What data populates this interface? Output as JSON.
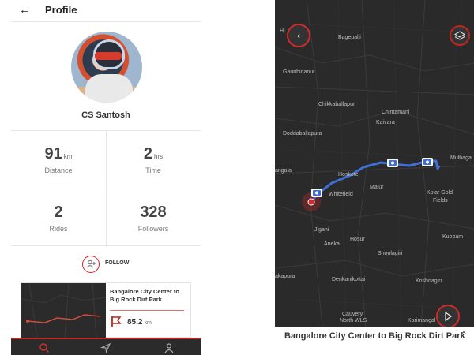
{
  "profile": {
    "header_title": "Profile",
    "name": "CS Santosh",
    "stats": [
      {
        "value": "91",
        "unit": "km",
        "label": "Distance"
      },
      {
        "value": "2",
        "unit": "hrs",
        "label": "Time"
      },
      {
        "value": "2",
        "unit": "",
        "label": "Rides"
      },
      {
        "value": "328",
        "unit": "",
        "label": "Followers"
      }
    ],
    "follow_label": "FOLLOW",
    "ride": {
      "title": "Bangalore City Center to Big Rock Dirt Park",
      "distance": "85.2",
      "distance_unit": "km"
    }
  },
  "map": {
    "labels": [
      "Bagepalli",
      "Gauribidanur",
      "Chikkaballapur",
      "Chintamani",
      "Kaivara",
      "Doddaballapura",
      "Hoskote",
      "Malur",
      "Mulbagal",
      "Whitefield",
      "Kolar Gold",
      "Fields",
      "Jigani",
      "Anekal",
      "Hosur",
      "Kuppam",
      "Shoolagiri",
      "Denkanikottai",
      "Krishnagiri",
      "Cauvery",
      "North WLS",
      "Karimangal",
      "Hi",
      "angala",
      "akapura"
    ],
    "route_title": "Bangalore City Center to Big Rock Dirt Park"
  },
  "colors": {
    "accent": "#d32b2b",
    "route": "#3d6fd6",
    "map_bg": "#2a2a2a"
  }
}
